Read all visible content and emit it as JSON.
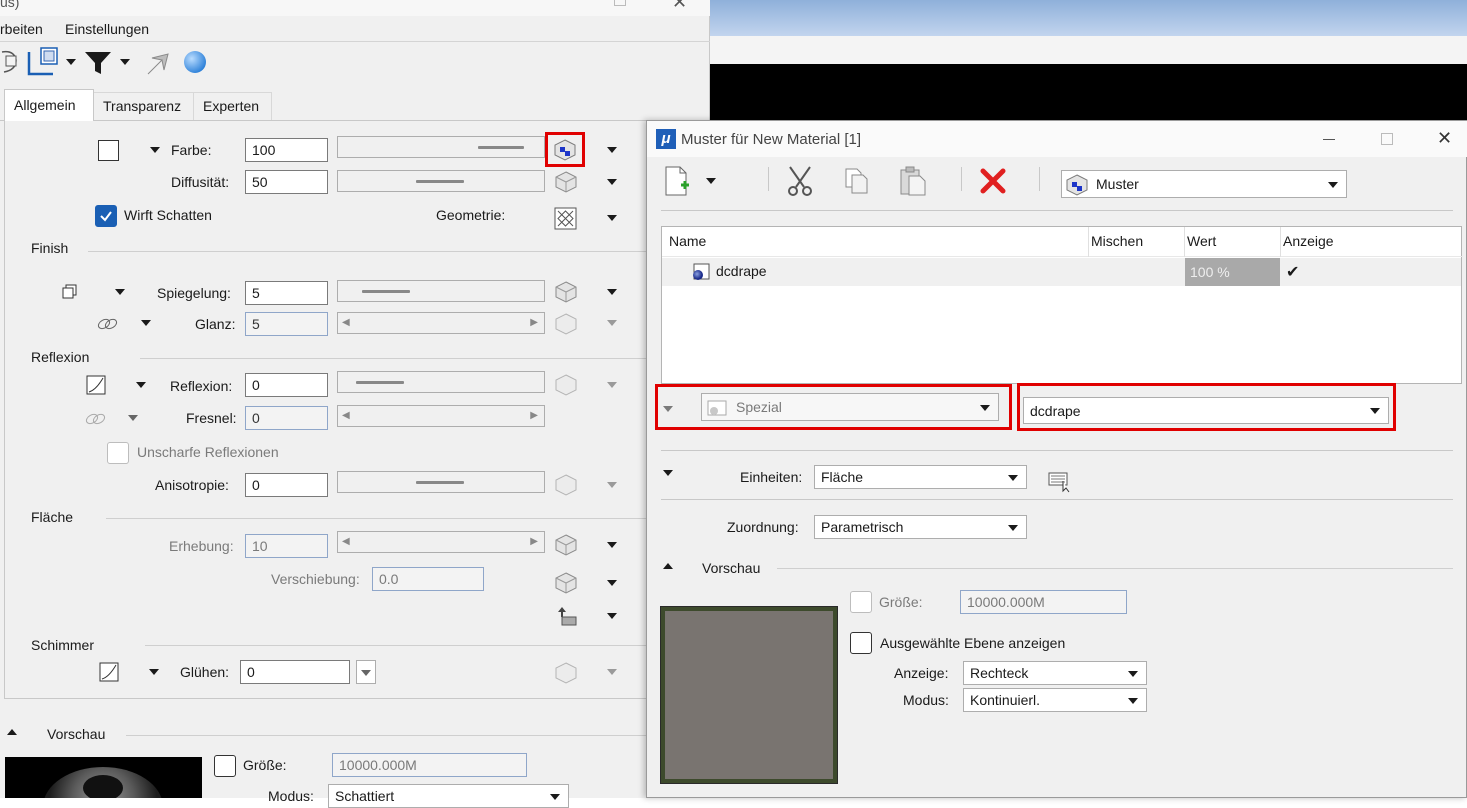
{
  "left_panel": {
    "title_partial": "us)",
    "menu": [
      "rbeiten",
      "Einstellungen"
    ],
    "tabs": [
      "Allgemein",
      "Transparenz",
      "Experten"
    ],
    "farbe": {
      "label": "Farbe:",
      "value": "100"
    },
    "diffusitaet": {
      "label": "Diffusität:",
      "value": "50"
    },
    "wirft_schatten": {
      "label": "Wirft Schatten",
      "checked": true
    },
    "geometrie": {
      "label": "Geometrie:"
    },
    "finish": {
      "heading": "Finish",
      "spiegelung": {
        "label": "Spiegelung:",
        "value": "5"
      },
      "glanz": {
        "label": "Glanz:",
        "value": "5"
      }
    },
    "reflexion": {
      "heading": "Reflexion",
      "reflexion": {
        "label": "Reflexion:",
        "value": "0"
      },
      "fresnel": {
        "label": "Fresnel:",
        "value": "0"
      },
      "unscharfe": {
        "label": "Unscharfe Reflexionen"
      },
      "anisotropie": {
        "label": "Anisotropie:",
        "value": "0"
      }
    },
    "flaeche": {
      "heading": "Fläche",
      "erhebung": {
        "label": "Erhebung:",
        "value": "10"
      },
      "verschiebung": {
        "label": "Verschiebung:",
        "value": "0.0"
      }
    },
    "schimmer": {
      "heading": "Schimmer",
      "gluehen": {
        "label": "Glühen:",
        "value": "0"
      }
    },
    "vorschau": {
      "heading": "Vorschau",
      "groesse": {
        "label": "Größe:",
        "value": "10000.000M"
      },
      "modus": {
        "label": "Modus:",
        "value": "Schattiert"
      }
    }
  },
  "dialog": {
    "title": "Muster für New Material [1]",
    "app_glyph": "μ",
    "muster_combo": "Muster",
    "table": {
      "columns": [
        "Name",
        "Mischen",
        "Wert",
        "Anzeige"
      ],
      "rows": [
        {
          "name": "dcdrape",
          "mischen": "",
          "wert": "100 %",
          "anzeige": "✔"
        }
      ]
    },
    "spezial_combo": "Spezial",
    "pattern_combo": "dcdrape",
    "einheiten": {
      "label": "Einheiten:",
      "value": "Fläche"
    },
    "zuordnung": {
      "label": "Zuordnung:",
      "value": "Parametrisch"
    },
    "vorschau": {
      "heading": "Vorschau",
      "groesse": {
        "label": "Größe:",
        "value": "10000.000M"
      },
      "ebene": {
        "label": "Ausgewählte Ebene anzeigen"
      },
      "anzeige": {
        "label": "Anzeige:",
        "value": "Rechteck"
      },
      "modus": {
        "label": "Modus:",
        "value": "Kontinuierl."
      }
    }
  },
  "colors": {
    "accent": "#1a5fb4",
    "highlight_red": "#e00000",
    "close_red": "#e02020"
  }
}
